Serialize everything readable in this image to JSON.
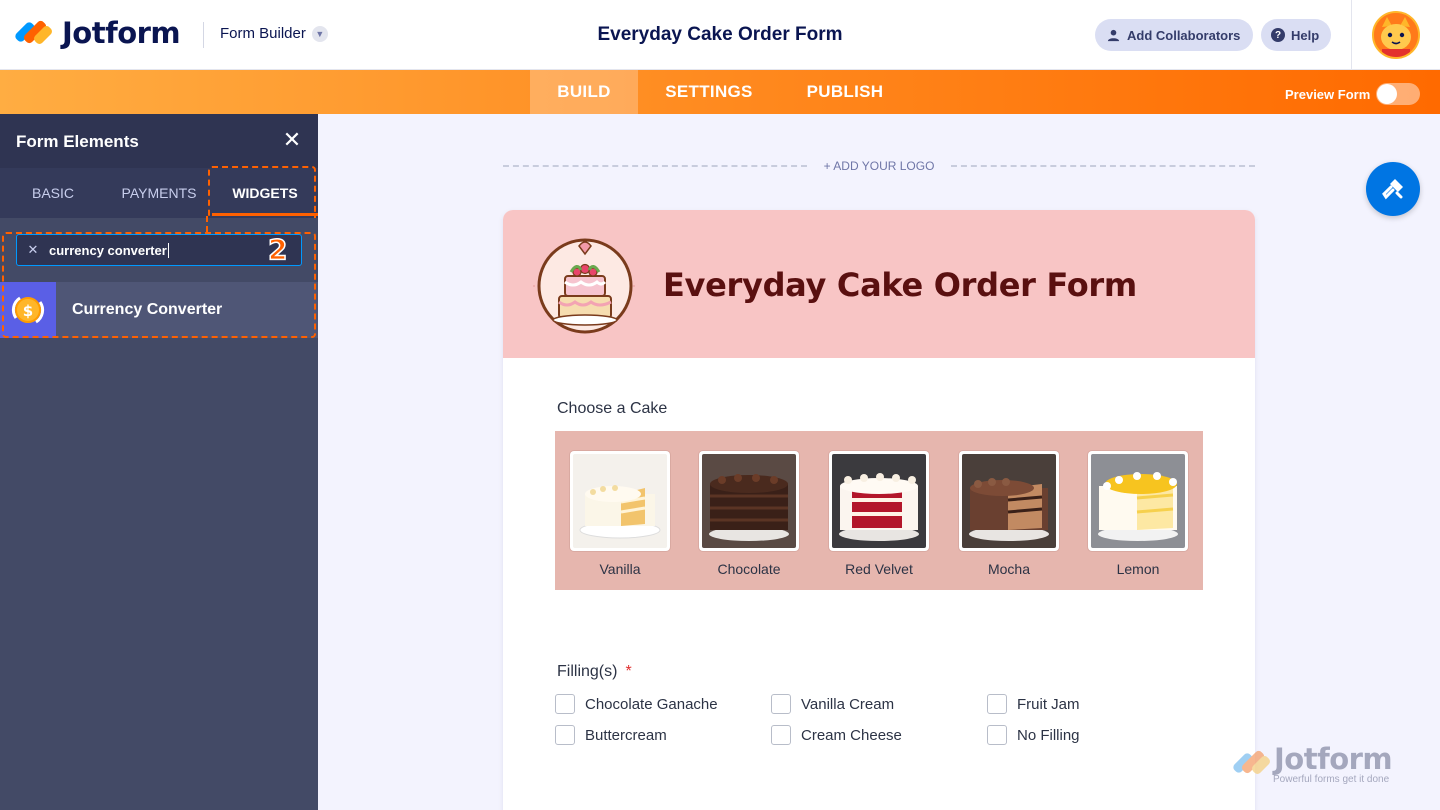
{
  "header": {
    "brand": "Jotform",
    "builder_label": "Form Builder",
    "form_title": "Everyday Cake Order Form",
    "collab_label": "Add Collaborators",
    "help_label": "Help"
  },
  "nav": {
    "tabs": [
      "BUILD",
      "SETTINGS",
      "PUBLISH"
    ],
    "active": "BUILD",
    "preview_label": "Preview Form",
    "preview_on": false
  },
  "panel": {
    "title": "Form Elements",
    "tabs": [
      "BASIC",
      "PAYMENTS",
      "WIDGETS"
    ],
    "active_tab": "WIDGETS",
    "search_value": "currency converter",
    "step_badge": "2",
    "results": [
      "Currency Converter"
    ]
  },
  "canvas": {
    "add_logo": "+ ADD YOUR LOGO"
  },
  "form": {
    "heading": "Everyday Cake Order Form",
    "q1_label": "Choose a Cake",
    "cakes": [
      "Vanilla",
      "Chocolate",
      "Red Velvet",
      "Mocha",
      "Lemon"
    ],
    "q2_label": "Filling(s)",
    "q2_required_mark": "*",
    "fillings": [
      "Chocolate Ganache",
      "Vanilla Cream",
      "Fruit Jam",
      "Buttercream",
      "Cream Cheese",
      "No Filling"
    ]
  },
  "watermark": {
    "brand": "Jotform",
    "tagline": "Powerful forms get it done"
  },
  "colors": {
    "brand_orange": "#ff6100",
    "brand_navy": "#0a1551",
    "form_header_bg": "#f8c5c5",
    "cake_strip_bg": "#e6b6ae",
    "panel_bg": "#434a66",
    "accent_blue": "#0075e3"
  }
}
